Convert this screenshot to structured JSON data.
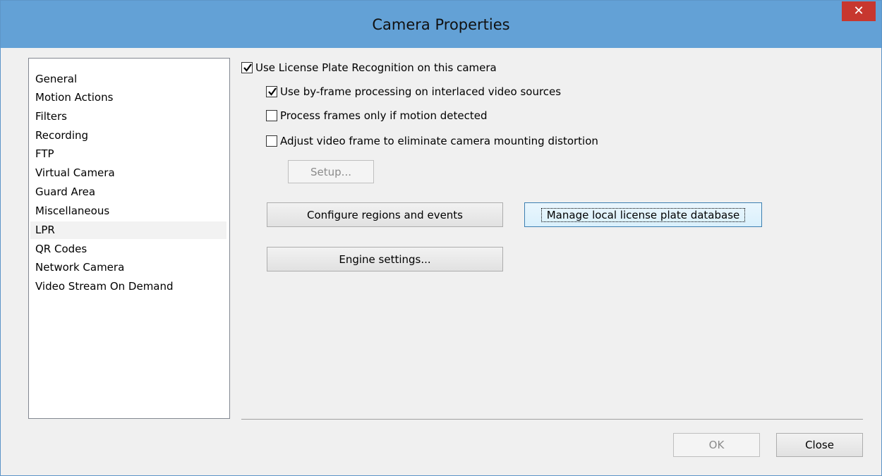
{
  "window": {
    "title": "Camera Properties",
    "close_glyph": "✕"
  },
  "sidebar": {
    "items": [
      "General",
      "Motion Actions",
      "Filters",
      "Recording",
      "FTP",
      "Virtual Camera",
      "Guard Area",
      "Miscellaneous",
      "LPR",
      "QR Codes",
      "Network Camera",
      "Video Stream On Demand"
    ],
    "selected": "LPR"
  },
  "lpr": {
    "use_lpr": {
      "label": "Use License Plate Recognition on this camera",
      "checked": true
    },
    "by_frame": {
      "label": "Use by-frame processing on interlaced video sources",
      "checked": true
    },
    "motion_only": {
      "label": "Process frames only if motion detected",
      "checked": false
    },
    "adjust_frame": {
      "label": "Adjust video frame to eliminate camera mounting distortion",
      "checked": false
    },
    "setup_button": "Setup...",
    "configure_button": "Configure regions and events",
    "manage_button": "Manage local license plate database",
    "engine_button": "Engine settings..."
  },
  "footer": {
    "ok_button": "OK",
    "close_button": "Close"
  }
}
